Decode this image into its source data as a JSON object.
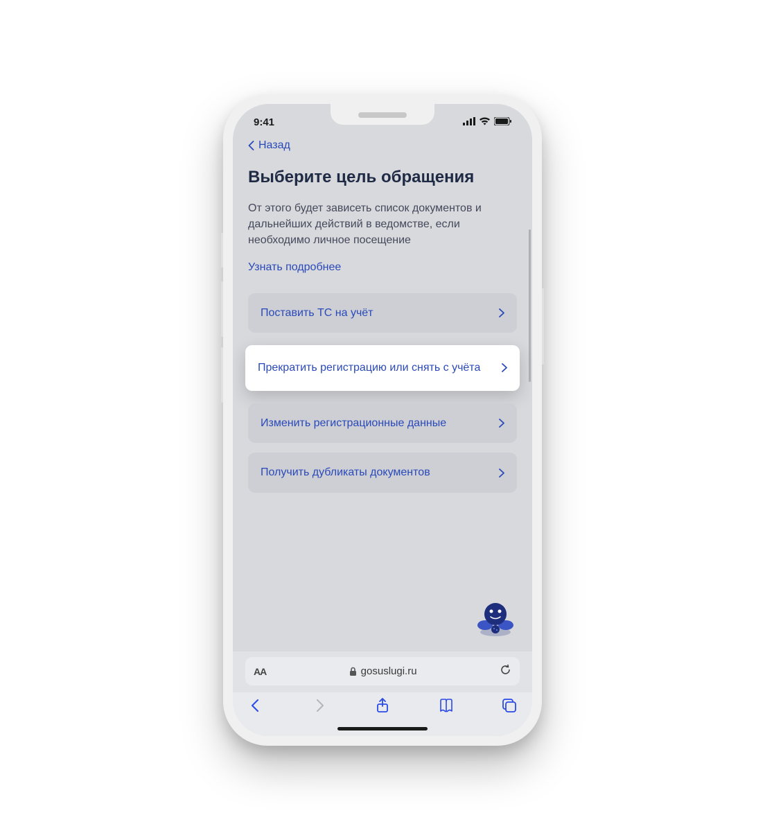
{
  "status": {
    "time": "9:41"
  },
  "nav": {
    "back_label": "Назад"
  },
  "page": {
    "title": "Выберите цель обращения",
    "subtitle": "От этого будет зависеть список документов и дальнейших действий в ведомстве, если необходимо личное посещение",
    "learn_more": "Узнать подробнее"
  },
  "options": [
    {
      "label": "Поставить ТС на учёт",
      "highlighted": false
    },
    {
      "label": "Прекратить регистрацию или снять с учёта",
      "highlighted": true
    },
    {
      "label": "Изменить регистрационные данные",
      "highlighted": false
    },
    {
      "label": "Получить дубликаты документов",
      "highlighted": false
    }
  ],
  "browser": {
    "text_size_label": "AA",
    "domain": "gosuslugi.ru"
  },
  "colors": {
    "accent": "#2a49b8",
    "page_bg": "#d8d9dd",
    "card_bg": "#cdcfd5",
    "highlight_bg": "#ffffff",
    "mascot_body": "#1d2e7c"
  }
}
